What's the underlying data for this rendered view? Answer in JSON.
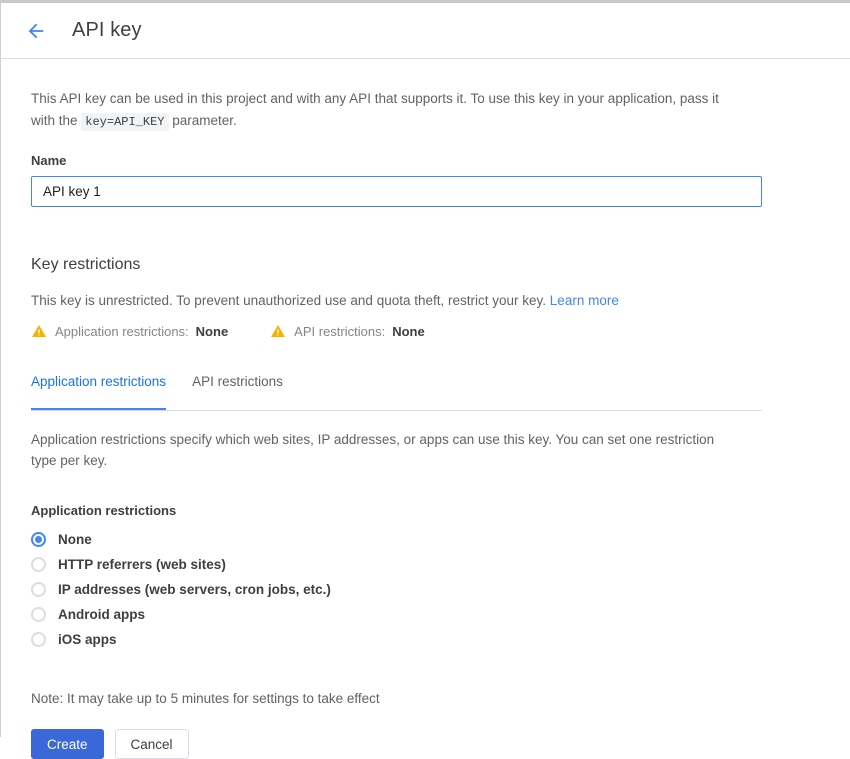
{
  "header": {
    "back_icon": "arrow-left-icon",
    "title": "API key"
  },
  "intro": {
    "text_before_code": "This API key can be used in this project and with any API that supports it. To use this key in your application, pass it with the ",
    "code": "key=API_KEY",
    "text_after_code": " parameter."
  },
  "name_field": {
    "label": "Name",
    "value": "API key 1",
    "placeholder": "Name"
  },
  "key_restrictions": {
    "title": "Key restrictions",
    "description": "This key is unrestricted. To prevent unauthorized use and quota theft, restrict your key.",
    "learn_more": "Learn more",
    "summary": [
      {
        "icon": "warning-icon",
        "label": "Application restrictions:",
        "value": "None"
      },
      {
        "icon": "warning-icon",
        "label": "API restrictions:",
        "value": "None"
      }
    ]
  },
  "tabs": [
    {
      "label": "Application restrictions",
      "active": true
    },
    {
      "label": "API restrictions",
      "active": false
    }
  ],
  "application_restrictions": {
    "description": "Application restrictions specify which web sites, IP addresses, or apps can use this key. You can set one restriction type per key.",
    "group_label": "Application restrictions",
    "options": [
      {
        "label": "None",
        "selected": true
      },
      {
        "label": "HTTP referrers (web sites)",
        "selected": false
      },
      {
        "label": "IP addresses (web servers, cron jobs, etc.)",
        "selected": false
      },
      {
        "label": "Android apps",
        "selected": false
      },
      {
        "label": "iOS apps",
        "selected": false
      }
    ]
  },
  "note": "Note: It may take up to 5 minutes for settings to take effect",
  "actions": {
    "create_label": "Create",
    "cancel_label": "Cancel"
  },
  "colors": {
    "accent_blue": "#4285f4",
    "link_blue": "#4285f4",
    "primary_button": "#3b68d8",
    "warning_amber": "#f4b400",
    "text_primary": "#3c4043",
    "text_secondary": "#5f6368",
    "border": "#dadce0"
  }
}
